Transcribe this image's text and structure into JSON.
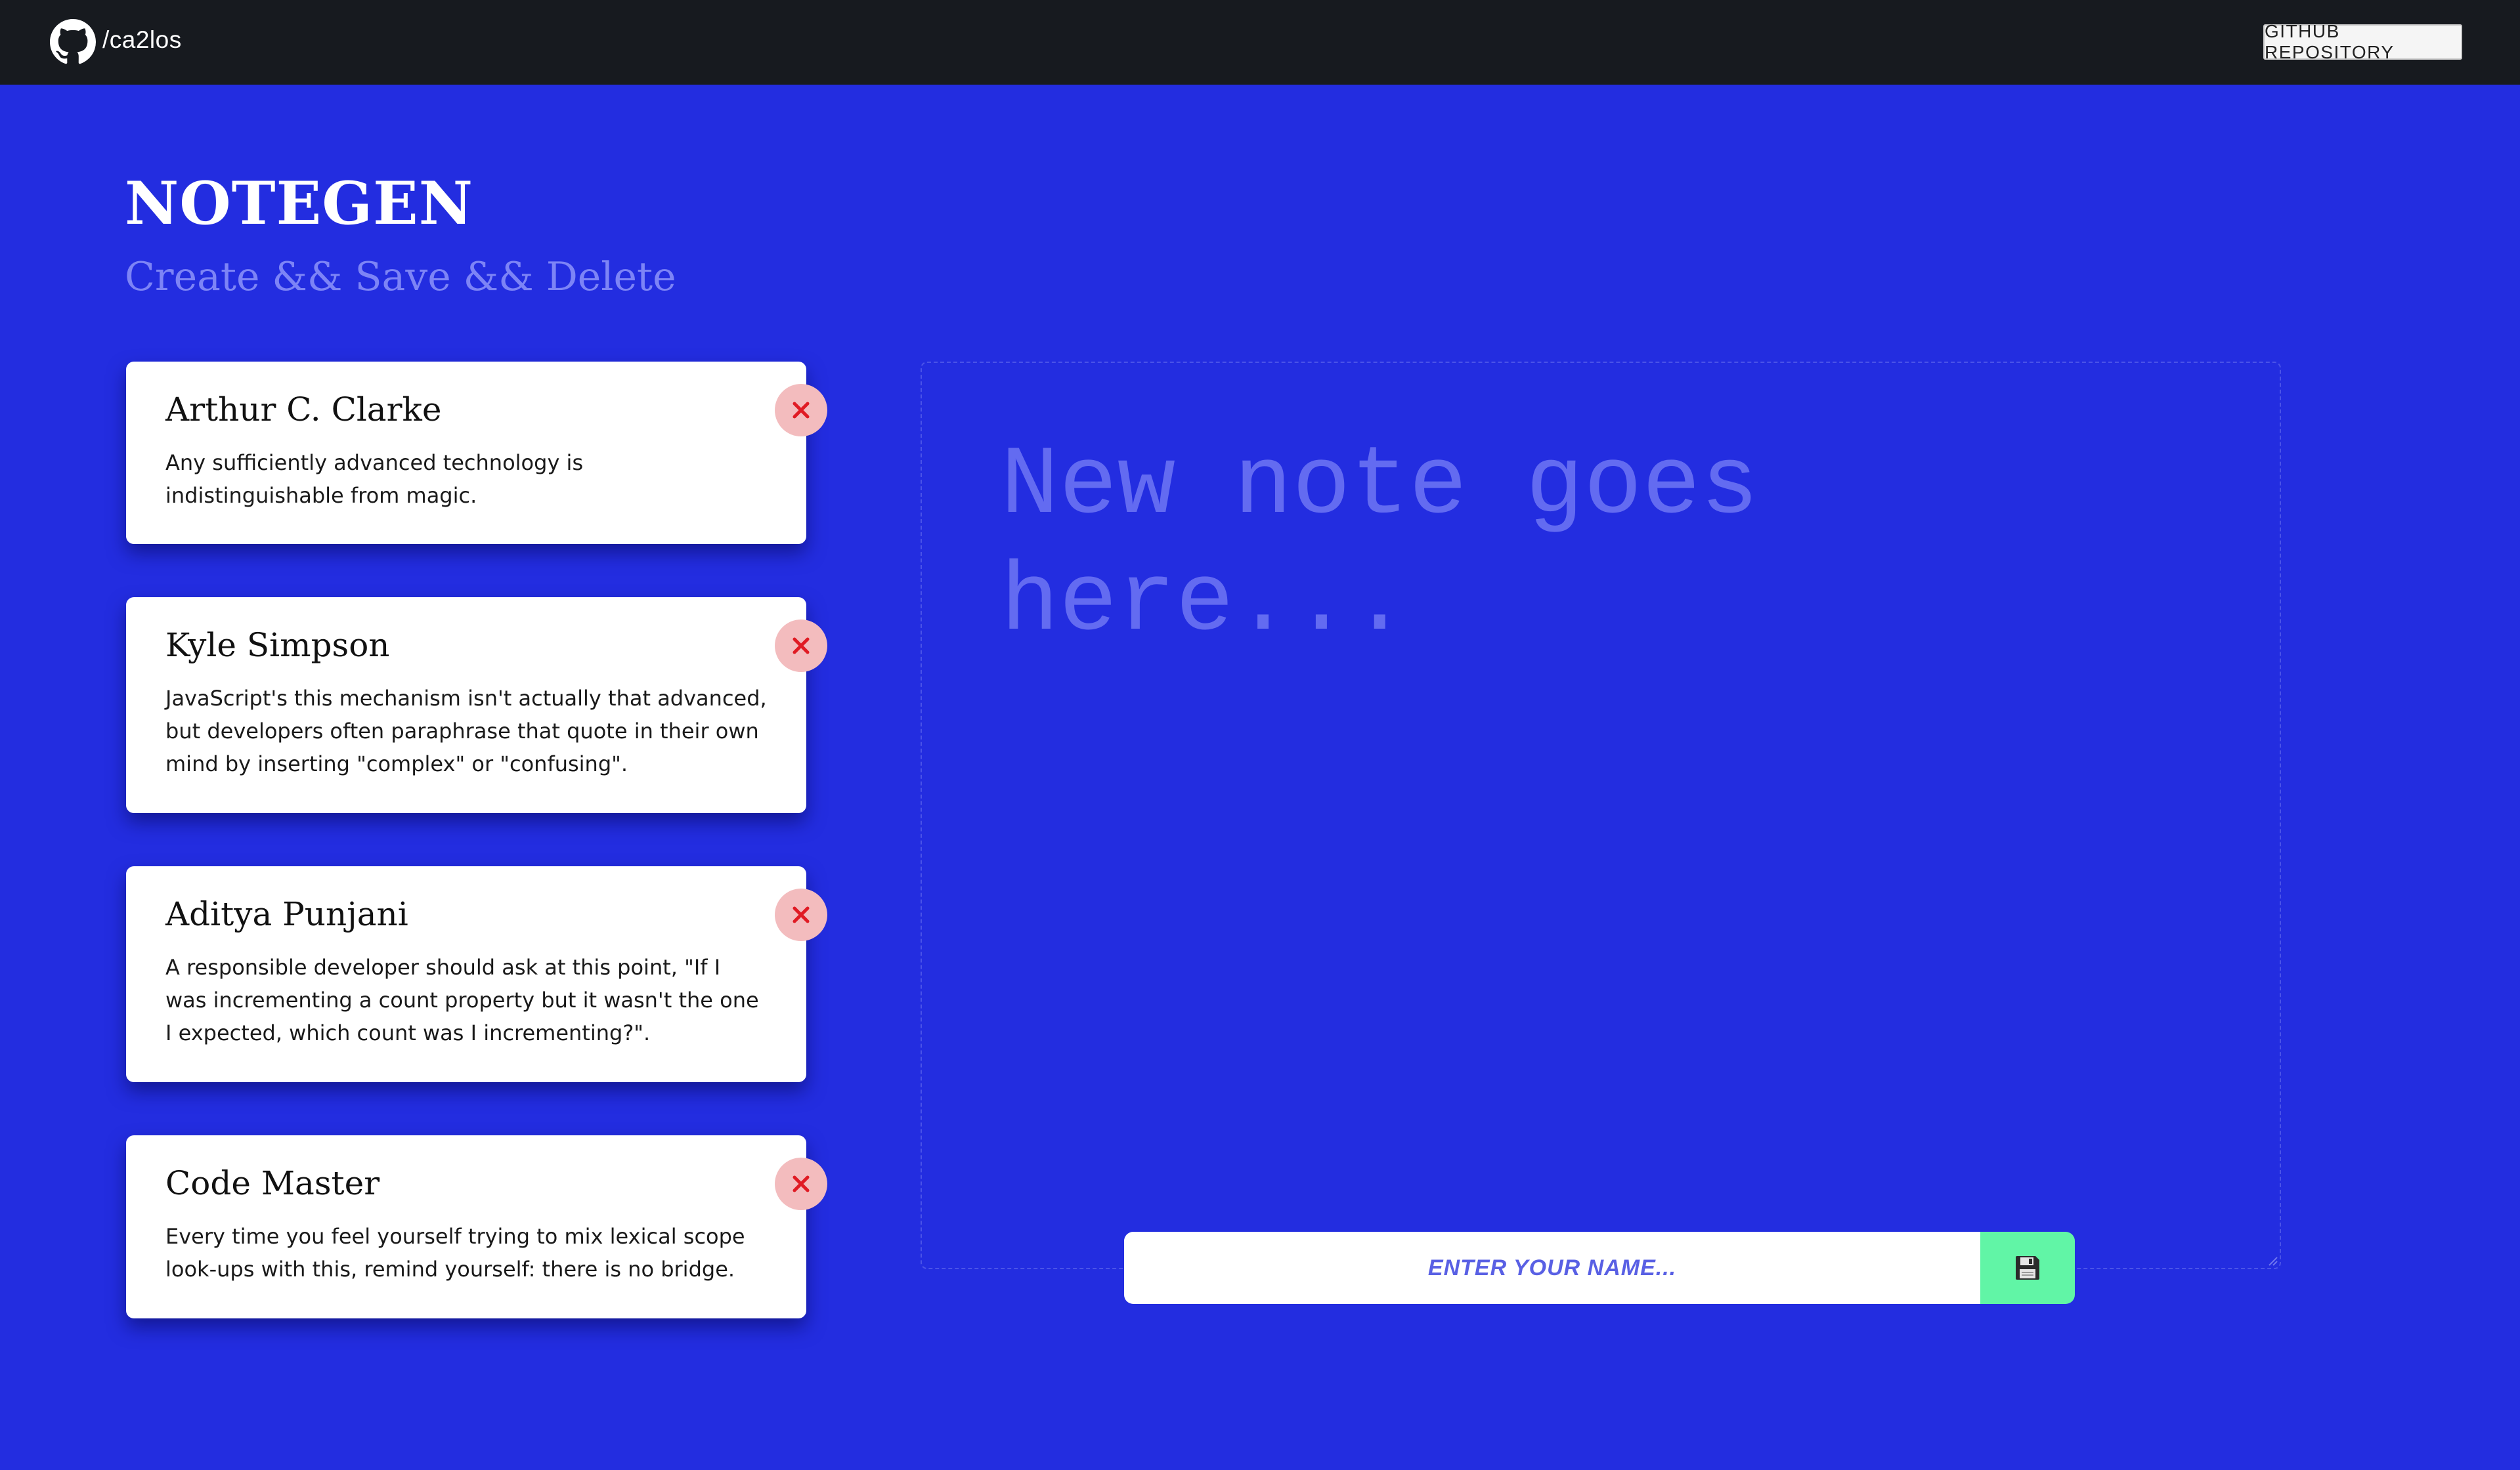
{
  "topbar": {
    "icon": "github-icon",
    "username": "/ca2los",
    "repo_button_label": "GITHUB REPOSITORY"
  },
  "header": {
    "title": "NOTEGEN",
    "subtitle": "Create && Save && Delete"
  },
  "notes": [
    {
      "name": "Arthur C. Clarke",
      "text": "Any sufficiently advanced technology is indistinguishable from magic."
    },
    {
      "name": "Kyle Simpson",
      "text": "JavaScript's this mechanism isn't actually that advanced, but developers often paraphrase that quote in their own mind by inserting \"complex\" or \"confusing\"."
    },
    {
      "name": "Aditya Punjani",
      "text": "A responsible developer should ask at this point, \"If I was incrementing a count property but it wasn't the one I expected, which count was I incrementing?\"."
    },
    {
      "name": "Code Master",
      "text": "Every time you feel yourself trying to mix lexical scope look-ups with this, remind yourself: there is no bridge."
    }
  ],
  "editor": {
    "placeholder": "New note goes here..."
  },
  "name_input": {
    "placeholder": "ENTER YOUR NAME..."
  },
  "save_button": {
    "icon": "floppy-disk-icon"
  },
  "colors": {
    "background": "#232de0",
    "topbar": "#171a1f",
    "subtitle": "#7d84f6",
    "delete_button": "#f3bcbe",
    "delete_icon": "#e01b24",
    "save_button": "#61f5a6"
  }
}
